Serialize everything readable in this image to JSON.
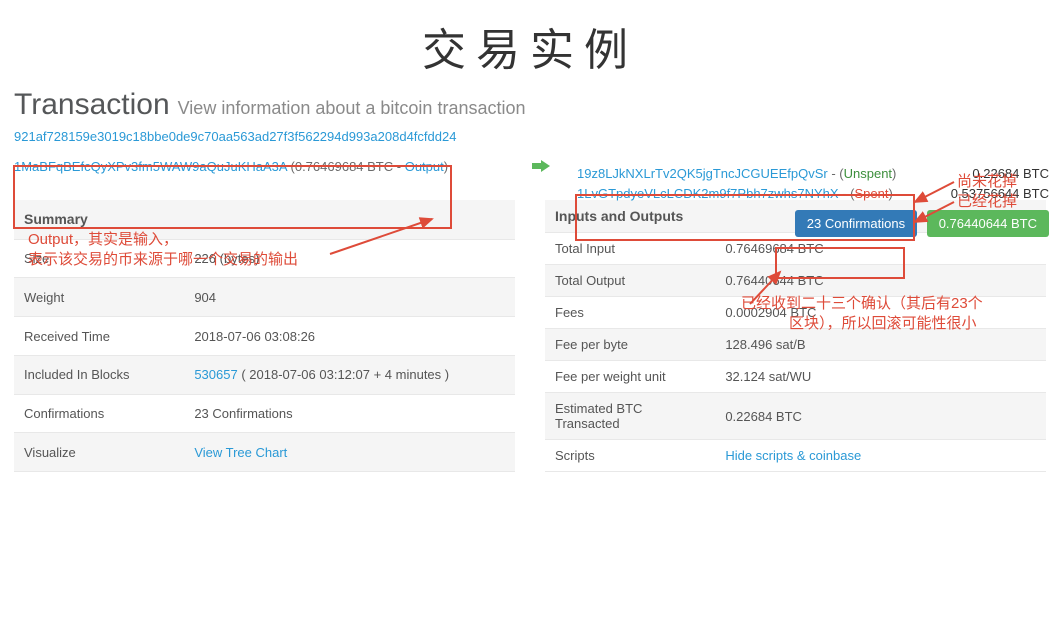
{
  "page_title": "交易实例",
  "header": {
    "title": "Transaction",
    "subtitle": "View information about a bitcoin transaction"
  },
  "tx": {
    "hash": "921af728159e3019c18bbe0de9c70aa563ad27f3f562294d993a208d4fcfdd24",
    "input_addr": "1MaBFqBEfcQyXPv3fm5WAW9aQuJuKHaA3A",
    "input_value": "0.76469684 BTC",
    "input_note": "Output",
    "outputs": [
      {
        "addr": "19z8LJkNXLrTv2QK5jgTncJCGUEEfpQvSr",
        "state": "Unspent",
        "state_class": "greenword",
        "amount": "0.22684 BTC"
      },
      {
        "addr": "1LvGTpdyeVLcLCDK2m9f7Pbh7zwhs7NYhX",
        "state": "Spent",
        "state_class": "redword",
        "amount": "0.53756644 BTC"
      }
    ],
    "confirm_badge": "23 Confirmations",
    "amount_badge": "0.76440644 BTC"
  },
  "summary": {
    "title": "Summary",
    "rows": [
      {
        "k": "Size",
        "v": "226 (bytes)"
      },
      {
        "k": "Weight",
        "v": "904"
      },
      {
        "k": "Received Time",
        "v": "2018-07-06 03:08:26"
      },
      {
        "k": "Included In Blocks",
        "v_link": "530657",
        "v_rest": " ( 2018-07-06 03:12:07 + 4 minutes )"
      },
      {
        "k": "Confirmations",
        "v": "23 Confirmations"
      },
      {
        "k": "Visualize",
        "v_link": "View Tree Chart"
      }
    ]
  },
  "io": {
    "title": "Inputs and Outputs",
    "rows": [
      {
        "k": "Total Input",
        "v": "0.76469684 BTC"
      },
      {
        "k": "Total Output",
        "v": "0.76440644 BTC"
      },
      {
        "k": "Fees",
        "v": "0.0002904 BTC"
      },
      {
        "k": "Fee per byte",
        "v": "128.496 sat/B"
      },
      {
        "k": "Fee per weight unit",
        "v": "32.124 sat/WU"
      },
      {
        "k": "Estimated BTC Transacted",
        "v": "0.22684 BTC"
      },
      {
        "k": "Scripts",
        "v_link": "Hide scripts & coinbase"
      }
    ]
  },
  "annotations": {
    "unspent": "尚未花掉",
    "spent": "已经花掉",
    "output_l1": "Output，其实是输入，",
    "output_l2": "表示该交易的币来源于哪一个交易的输出",
    "confirm_l1": "已经收到二十三个确认（其后有23个",
    "confirm_l2": "区块），所以回滚可能性很小"
  }
}
